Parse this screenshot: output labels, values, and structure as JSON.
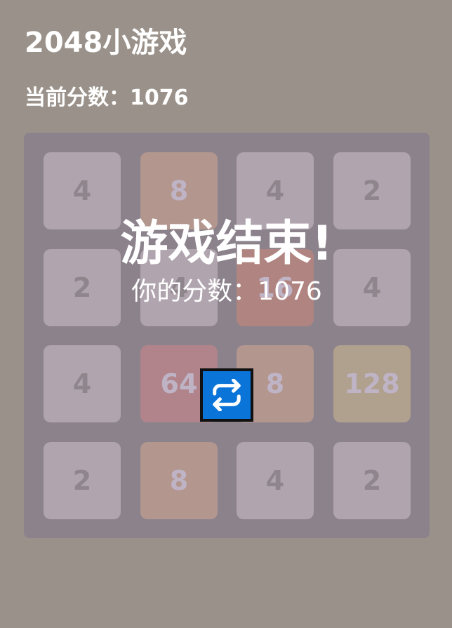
{
  "header": {
    "title": "2048小游戏",
    "score_line": "当前分数：1076"
  },
  "board": {
    "size": 4,
    "tiles": [
      [
        4,
        8,
        4,
        2
      ],
      [
        2,
        4,
        16,
        4
      ],
      [
        4,
        64,
        8,
        128
      ],
      [
        2,
        8,
        4,
        2
      ]
    ]
  },
  "tile_colors": {
    "2": {
      "bg": "#b0a5ae",
      "fg": "#8f858c"
    },
    "4": {
      "bg": "#b0a5ae",
      "fg": "#8f858c"
    },
    "8": {
      "bg": "#b3978f",
      "fg": "#bfb3c6"
    },
    "16": {
      "bg": "#b08480",
      "fg": "#bfb3c6"
    },
    "64": {
      "bg": "#b0848a",
      "fg": "#bfb3c6"
    },
    "128": {
      "bg": "#b0a08e",
      "fg": "#bfb3c6"
    }
  },
  "game_over": {
    "title": "游戏结束!",
    "score_text": "你的分数：1076",
    "restart_icon": "repeat-icon"
  },
  "colors": {
    "background": "#9a928a",
    "board": "#8b828c",
    "restart_button": "#0a74d8"
  }
}
